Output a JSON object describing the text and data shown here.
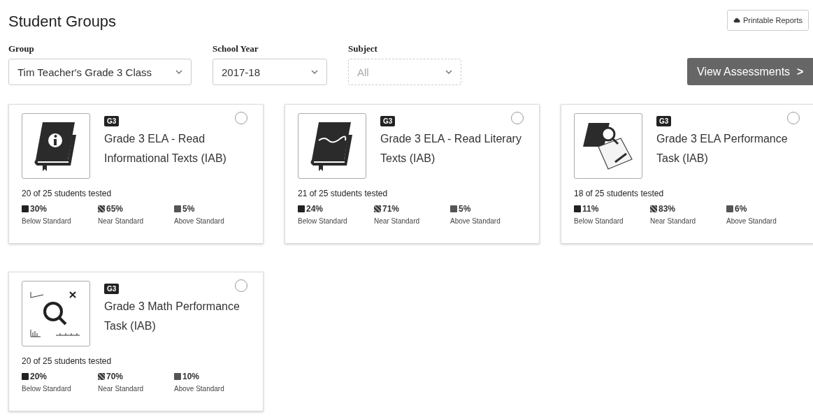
{
  "title": "Student Groups",
  "printable_reports": {
    "label": "Printable Reports"
  },
  "filters": [
    {
      "label": "Group",
      "value": "Tim Teacher's Grade 3 Class",
      "disabled": false
    },
    {
      "label": "School Year",
      "value": "2017-18",
      "disabled": false
    },
    {
      "label": "Subject",
      "value": "All",
      "disabled": true
    }
  ],
  "view_button": {
    "label": "View Assessments",
    "caret": ">"
  },
  "cards": [
    {
      "kind": "info-book",
      "badge": "G3",
      "title": "Grade 3 ELA - Read Informational Texts (IAB)",
      "tested": "20 of 25 students tested",
      "selected": false,
      "levels": [
        {
          "percent": "30%",
          "label": "Below Standard"
        },
        {
          "percent": "65%",
          "label": "Near Standard"
        },
        {
          "percent": "5%",
          "label": "Above Standard"
        }
      ]
    },
    {
      "kind": "literature-book",
      "badge": "G3",
      "title": "Grade 3 ELA - Read Literary Texts (IAB)",
      "tested": "21 of 25 students tested",
      "selected": false,
      "levels": [
        {
          "percent": "24%",
          "label": "Below Standard"
        },
        {
          "percent": "71%",
          "label": "Near Standard"
        },
        {
          "percent": "5%",
          "label": "Above Standard"
        }
      ]
    },
    {
      "kind": "ela-task",
      "badge": "G3",
      "title": "Grade 3 ELA Performance Task (IAB)",
      "tested": "18 of 25 students tested",
      "selected": false,
      "levels": [
        {
          "percent": "11%",
          "label": "Below Standard"
        },
        {
          "percent": "83%",
          "label": "Near Standard"
        },
        {
          "percent": "6%",
          "label": "Above Standard"
        }
      ]
    },
    {
      "kind": "math-task",
      "badge": "G3",
      "title": "Grade 3 Math Performance Task (IAB)",
      "tested": "20 of 25 students tested",
      "selected": false,
      "levels": [
        {
          "percent": "20%",
          "label": "Below Standard"
        },
        {
          "percent": "70%",
          "label": "Near Standard"
        },
        {
          "percent": "10%",
          "label": "Above Standard"
        }
      ]
    }
  ]
}
